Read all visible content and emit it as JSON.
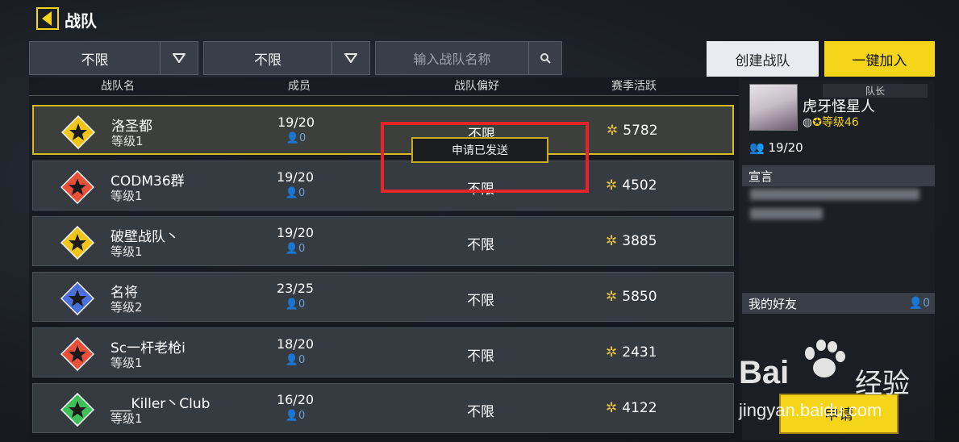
{
  "header": {
    "title": "战队"
  },
  "filters": [
    {
      "value": "不限"
    },
    {
      "value": "不限"
    }
  ],
  "search": {
    "placeholder": "输入战队名称"
  },
  "buttons": {
    "create": "创建战队",
    "quick_join": "一键加入",
    "apply": "申请"
  },
  "table": {
    "columns": [
      "战队名",
      "成员",
      "战队偏好",
      "赛季活跃"
    ],
    "rows": [
      {
        "name": "洛圣都",
        "level": "等级1",
        "members": "19/20",
        "pending": "0",
        "preference": "不限",
        "activity": "5782",
        "emblem_color": "#f0c419",
        "selected": true
      },
      {
        "name": "CODM36群",
        "level": "等级1",
        "members": "19/20",
        "pending": "0",
        "preference": "不限",
        "activity": "4502",
        "emblem_color": "#e8503a"
      },
      {
        "name": "破壁战队丶",
        "level": "等级1",
        "members": "19/20",
        "pending": "0",
        "preference": "不限",
        "activity": "3885",
        "emblem_color": "#f0c419"
      },
      {
        "name": "名将",
        "level": "等级2",
        "members": "23/25",
        "pending": "0",
        "preference": "不限",
        "activity": "5850",
        "emblem_color": "#4a6fd8"
      },
      {
        "name": "Sc一杆老枪i",
        "level": "等级1",
        "members": "18/20",
        "pending": "0",
        "preference": "不限",
        "activity": "2431",
        "emblem_color": "#e8503a"
      },
      {
        "name": "___Killer丶Club",
        "level": "等级1",
        "members": "16/20",
        "pending": "0",
        "preference": "不限",
        "activity": "4122",
        "emblem_color": "#3fbf5a"
      }
    ]
  },
  "toast": {
    "text": "申请已发送"
  },
  "captain": {
    "label": "队长",
    "name": "虎牙怪星人",
    "level": "等级46",
    "count": "19/20"
  },
  "manifesto": {
    "title": "宣言"
  },
  "friends": {
    "title": "我的好友",
    "count": "0"
  },
  "watermark": {
    "logo": "Bai",
    "logo2": "经验",
    "url": "jingyan.baidu.com"
  },
  "colors": {
    "accent_yellow": "#f4d51a",
    "selected_border": "#d9b91e",
    "highlight_red": "#e3262a"
  }
}
